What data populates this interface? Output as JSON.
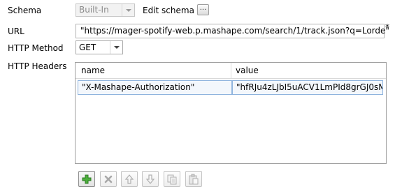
{
  "schema": {
    "label": "Schema",
    "value": "Built-In",
    "edit_label": "Edit schema",
    "edit_button": "..."
  },
  "url": {
    "label": "URL",
    "value": "\"https://mager-spotify-web.p.mashape.com/search/1/track.json?q=Lorde\"",
    "required_mark": "*"
  },
  "http_method": {
    "label": "HTTP Method",
    "value": "GET"
  },
  "headers": {
    "label": "HTTP Headers",
    "columns": [
      "name",
      "value"
    ],
    "rows": [
      [
        "\"X-Mashape-Authorization\"",
        "\"hfRJu4zLJbI5uACV1LmPId8grGJ0sM..."
      ]
    ]
  },
  "toolbar": {
    "buttons": [
      {
        "icon": "add-icon",
        "enabled": true
      },
      {
        "icon": "delete-icon",
        "enabled": false
      },
      {
        "icon": "move-up-icon",
        "enabled": false
      },
      {
        "icon": "move-down-icon",
        "enabled": false
      },
      {
        "icon": "copy-icon",
        "enabled": false
      },
      {
        "icon": "paste-icon",
        "enabled": false
      }
    ]
  },
  "colors": {
    "selection_border": "#8fb4de",
    "add_icon_green": "#3a9a2f"
  }
}
